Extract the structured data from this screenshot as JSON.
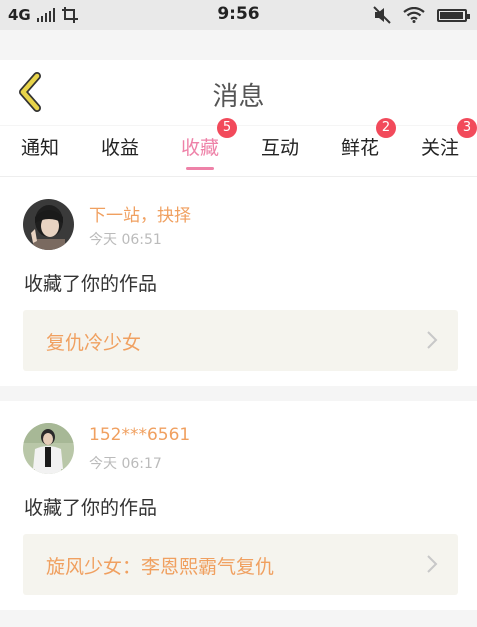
{
  "status_bar": {
    "network": "4G",
    "time": "9:56",
    "battery_level": 0.95
  },
  "header": {
    "title": "消息",
    "back_icon": "chevron-left-icon"
  },
  "tabs": [
    {
      "label": "通知",
      "badge": ""
    },
    {
      "label": "收益",
      "badge": ""
    },
    {
      "label": "收藏",
      "badge": "5",
      "active": true
    },
    {
      "label": "互动",
      "badge": ""
    },
    {
      "label": "鲜花",
      "badge": "2"
    },
    {
      "label": "关注",
      "badge": "3"
    }
  ],
  "messages": [
    {
      "username": "下一站，抉择",
      "time": "今天 06:51",
      "action": "收藏了你的作品",
      "work_title": "复仇冷少女"
    },
    {
      "username": "152***6561",
      "time": "今天 06:17",
      "action": "收藏了你的作品",
      "work_title": "旋风少女：李恩熙霸气复仇"
    }
  ],
  "colors": {
    "accent_pink": "#ee82a8",
    "username_orange": "#f0a060",
    "badge_red": "#f24a5b",
    "back_icon_yellow": "#e8d44a"
  }
}
